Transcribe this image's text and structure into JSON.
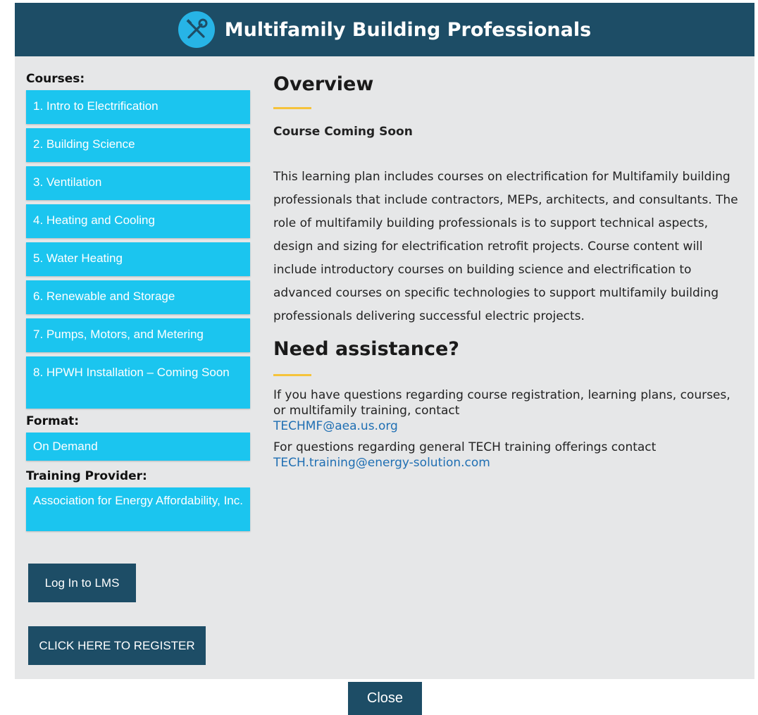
{
  "header": {
    "title": "Multifamily Building Professionals",
    "logo_icon": "tools-icon"
  },
  "sidebar": {
    "courses_label": "Courses:",
    "courses": [
      "1. Intro to Electrification",
      "2. Building Science",
      "3. Ventilation",
      "4. Heating and Cooling",
      "5. Water Heating",
      "6. Renewable and Storage",
      "7. Pumps, Motors, and Metering",
      "8. HPWH Installation – Coming Soon"
    ],
    "format_label": "Format:",
    "format_value": "On Demand",
    "provider_label": "Training Provider:",
    "provider_value": "Association for Energy Affordability, Inc.",
    "login_label": "Log In to LMS",
    "register_label": "CLICK HERE TO REGISTER"
  },
  "content": {
    "overview_title": "Overview",
    "coming_soon": "Course Coming Soon",
    "description": "This learning plan includes courses on electrification for Multifamily building professionals that include contractors, MEPs, architects, and consultants. The role of multifamily building professionals is to support technical aspects, design and sizing for electrification retrofit projects. Course content will include introductory courses on building science and electrification to advanced courses on specific technologies to support multifamily building professionals delivering successful electric projects.",
    "assistance_title": "Need assistance?",
    "assist_text_1": "If you have questions regarding course registration, learning plans, courses, or multifamily training, contact",
    "assist_email_1": "TECHMF@aea.us.org",
    "assist_text_2": "For questions regarding general TECH training offerings contact",
    "assist_email_2": "TECH.training@energy-solution.com"
  },
  "footer": {
    "close_label": "Close"
  },
  "colors": {
    "header_bg": "#1d4d66",
    "button_cyan": "#1bc5ef",
    "accent_yellow": "#f5c33b",
    "link_blue": "#1f6fb3"
  }
}
